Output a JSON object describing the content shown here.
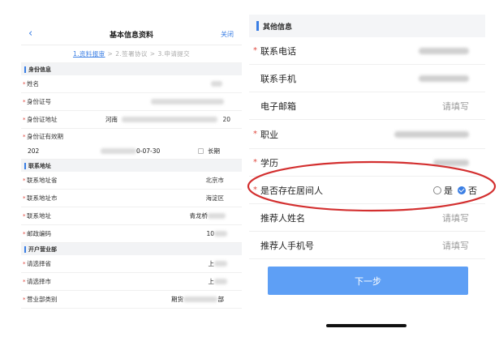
{
  "left_screen": {
    "nav": {
      "back_icon": "chevron-left-icon",
      "title": "基本信息资料",
      "close": "关闭"
    },
    "steps": {
      "step1": "1.资料报审",
      "step2": "2.签署协议",
      "step3": "3.申请提交",
      "separator": ">"
    },
    "identity_section": {
      "title": "身份信息",
      "name_label": "姓名",
      "id_number_label": "身份证号",
      "id_address_label": "身份证地址",
      "id_address_value_start": "河南",
      "id_address_value_end": "20",
      "id_validity_label": "身份证有效期",
      "id_validity_start": "202",
      "id_validity_end": "0-07-30",
      "long_term_label": "长期"
    },
    "contact_section": {
      "title": "联系地址",
      "province_label": "联系地址省",
      "province_value": "北京市",
      "city_label": "联系地址市",
      "city_value": "海淀区",
      "address_label": "联系地址",
      "address_value": "青龙桥",
      "postcode_label": "邮政编码",
      "postcode_value": "10"
    },
    "branch_section": {
      "title": "开户营业部",
      "select_province_label": "请选择省",
      "select_province_value": "上",
      "select_city_label": "请选择市",
      "select_city_value": "上",
      "branch_type_label": "营业部类别",
      "branch_type_value_start": "期货",
      "branch_type_value_end": "部"
    }
  },
  "right_screen": {
    "other_section_title": "其他信息",
    "phone_label": "联系电话",
    "mobile_label": "联系手机",
    "email_label": "电子邮箱",
    "email_placeholder": "请填写",
    "occupation_label": "职业",
    "education_label": "学历",
    "intermediary_label": "是否存在居间人",
    "radio_yes": "是",
    "radio_no": "否",
    "radio_selected": "否",
    "referrer_name_label": "推荐人姓名",
    "referrer_name_placeholder": "请填写",
    "referrer_phone_label": "推荐人手机号",
    "referrer_phone_placeholder": "请填写",
    "next_button": "下一步"
  },
  "colors": {
    "accent": "#3a7ee4",
    "required": "#e0483e",
    "button": "#5e9ff5",
    "annotation": "#d32f2f"
  }
}
